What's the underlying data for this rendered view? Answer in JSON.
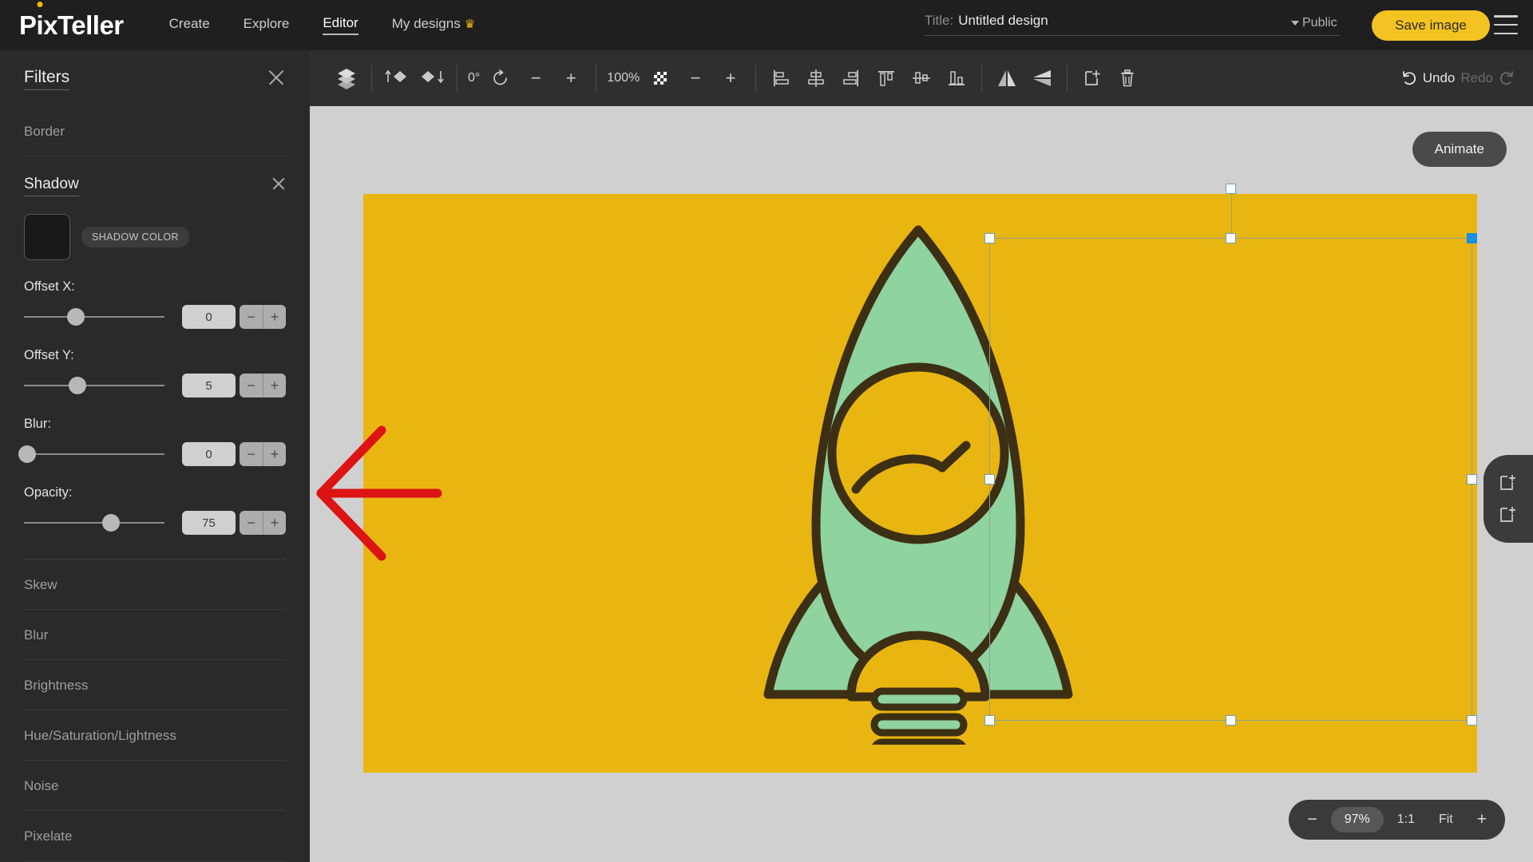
{
  "app": {
    "logo_pre": "P",
    "logo_i": "i",
    "logo_post": "xTeller"
  },
  "topnav": {
    "links": [
      {
        "label": "Create",
        "active": false
      },
      {
        "label": "Explore",
        "active": false
      },
      {
        "label": "Editor",
        "active": true
      },
      {
        "label": "My designs",
        "active": false,
        "icon": "crown-icon",
        "crown": "♛"
      }
    ],
    "title_label": "Title:",
    "title_value": "Untitled design",
    "title_placeholder": "Untitled design",
    "visibility": "Public",
    "save_button": "Save image",
    "menu_icon": "hamburger-menu-icon"
  },
  "sidebar": {
    "panel_title": "Filters",
    "close_icon": "close-icon",
    "border_section": "Border",
    "shadow": {
      "title": "Shadow",
      "close_icon": "close-icon",
      "color_tag": "SHADOW COLOR",
      "color_value": "#191919",
      "sliders": [
        {
          "label": "Offset X:",
          "value": "0",
          "pct": 37,
          "minus": "−",
          "plus": "+"
        },
        {
          "label": "Offset Y:",
          "value": "5",
          "pct": 38,
          "minus": "−",
          "plus": "+"
        },
        {
          "label": "Blur:",
          "value": "0",
          "pct": 2,
          "minus": "−",
          "plus": "+"
        },
        {
          "label": "Opacity:",
          "value": "75",
          "pct": 62,
          "minus": "−",
          "plus": "+"
        }
      ]
    },
    "filters": [
      {
        "label": "Skew"
      },
      {
        "label": "Blur"
      },
      {
        "label": "Brightness"
      },
      {
        "label": "Hue/Saturation/Lightness"
      },
      {
        "label": "Noise"
      },
      {
        "label": "Pixelate"
      }
    ]
  },
  "toolbar": {
    "layers_icon": "layers-icon",
    "bring_forward_icon": "bring-forward-icon",
    "send_backward_icon": "send-backward-icon",
    "rotation_value": "0°",
    "rotate_icon": "rotate-icon",
    "rotate_minus": "−",
    "rotate_plus": "+",
    "opacity_value": "100%",
    "opacity_icon": "checkerboard-opacity-icon",
    "opacity_minus": "−",
    "opacity_plus": "+",
    "align_icons": [
      "align-left-icon",
      "align-center-horizontal-icon",
      "align-right-icon",
      "align-top-icon",
      "align-middle-vertical-icon",
      "align-bottom-icon"
    ],
    "flip_horizontal_icon": "flip-horizontal-icon",
    "flip_vertical_icon": "flip-vertical-icon",
    "duplicate_icon": "duplicate-icon",
    "delete_icon": "trash-delete-icon",
    "undo_label": "Undo",
    "undo_icon": "undo-arrow-icon",
    "redo_label": "Redo",
    "redo_icon": "redo-arrow-icon"
  },
  "workspace": {
    "canvas_bg": "#e9b511",
    "workspace_bg": "#d0d0d0",
    "animate_button": "Animate",
    "add_frame_icon": "add-frame-icon",
    "duplicate_frame_icon": "duplicate-frame-icon",
    "annotation_arrow": {
      "name": "red-arrow-annotation",
      "color": "#dc1414"
    },
    "artwork": {
      "name": "rocket-illustration",
      "body_color": "#8ed3a0",
      "outline_color": "#3d2f14"
    },
    "selection": {
      "name": "selection-bounding-box",
      "border_color": "#8aa58a",
      "handle_fill": "#ffffff",
      "handle_border": "#69a0c8",
      "active_handle": "#1b8fe0"
    },
    "zoom": {
      "minus": "−",
      "level": "97%",
      "actual_size": "1:1",
      "fit": "Fit",
      "plus": "+"
    }
  }
}
